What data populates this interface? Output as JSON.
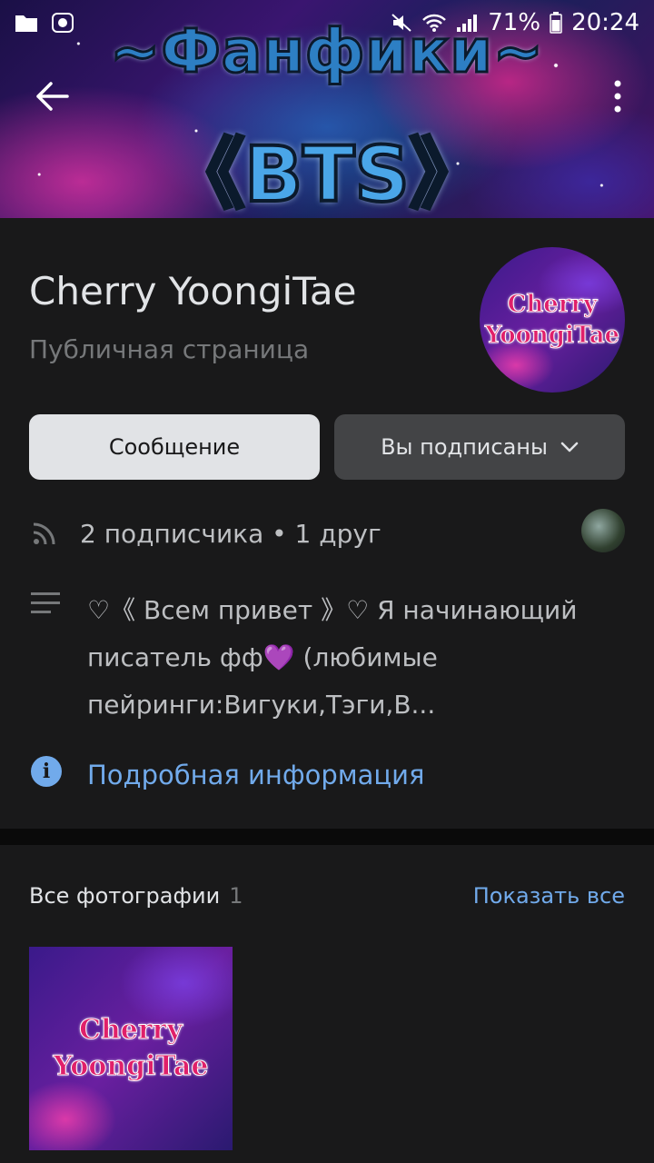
{
  "status_bar": {
    "battery": "71%",
    "time": "20:24"
  },
  "cover": {
    "title": "~Фанфики~",
    "subtitle": "《BTS》"
  },
  "profile": {
    "name": "Cherry YoongiTae",
    "type": "Публичная страница",
    "avatar_text_1": "Cherry",
    "avatar_text_2": "YoongiTae"
  },
  "actions": {
    "message_label": "Сообщение",
    "subscribed_label": "Вы подписаны"
  },
  "stats": {
    "followers_text": "2 подписчика • 1 друг"
  },
  "description": {
    "text": "♡《 Всем привет 》♡ Я начинающий писатель фф💜 (любимые пейринги:Вигуки,Тэги,В..."
  },
  "info": {
    "link_label": "Подробная информация"
  },
  "photos": {
    "title": "Все фотографии",
    "count": "1",
    "show_all": "Показать все",
    "photo_text_1": "Cherry",
    "photo_text_2": "YoongiTae"
  },
  "colors": {
    "background": "#19191a",
    "accent": "#71aaeb",
    "button_light": "#e1e3e6",
    "button_dark": "#434446"
  },
  "icons": [
    "folder-icon",
    "bug-icon",
    "mute-icon",
    "wifi-icon",
    "signal-icon",
    "battery-icon",
    "back-arrow-icon",
    "more-vertical-icon",
    "chevron-down-icon",
    "followers-icon",
    "description-icon",
    "info-icon"
  ]
}
